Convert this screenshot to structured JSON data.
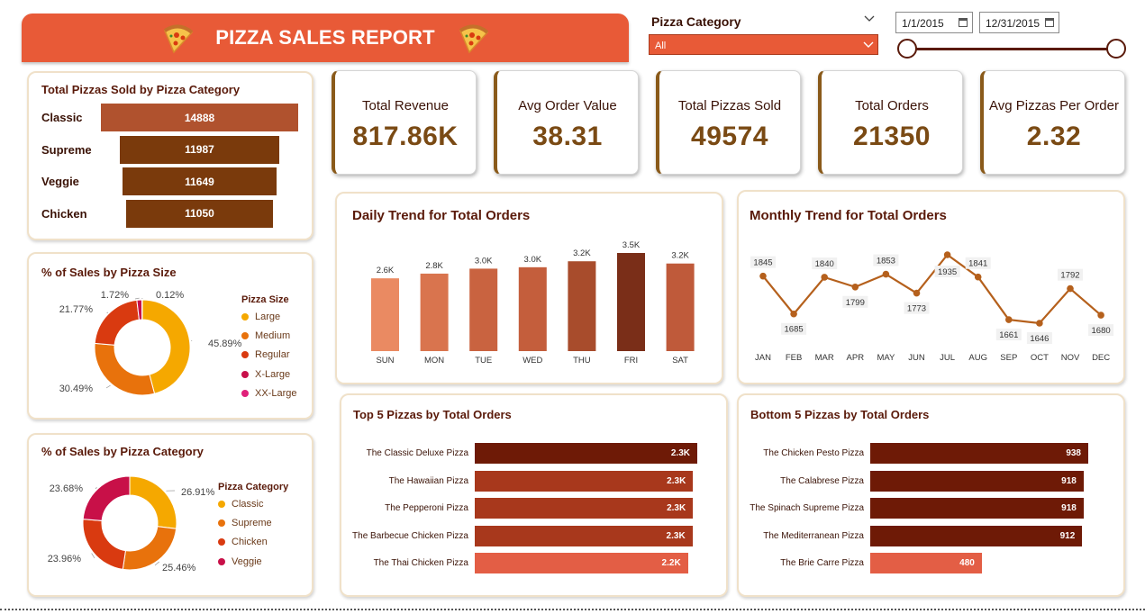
{
  "header": {
    "title": "PIZZA SALES REPORT"
  },
  "slicers": {
    "category_label": "Pizza Category",
    "category_value": "All",
    "date_start": "1/1/2015",
    "date_end": "12/31/2015"
  },
  "kpis": [
    {
      "label": "Total Revenue",
      "value": "817.86K"
    },
    {
      "label": "Avg Order Value",
      "value": "38.31"
    },
    {
      "label": "Total Pizzas Sold",
      "value": "49574"
    },
    {
      "label": "Total Orders",
      "value": "21350"
    },
    {
      "label": "Avg Pizzas Per Order",
      "value": "2.32"
    }
  ],
  "titles": {
    "funnel": "Total Pizzas Sold by Pizza Category",
    "size_donut": "% of Sales by Pizza Size",
    "cat_donut": "% of Sales by Pizza Category",
    "daily": "Daily Trend for Total Orders",
    "monthly": "Monthly Trend for Total Orders",
    "top5": "Top 5 Pizzas by Total Orders",
    "bottom5": "Bottom 5 Pizzas by Total Orders"
  },
  "colors": {
    "header": "#e85a37",
    "large": "#f5a800",
    "medium": "#e8720c",
    "regular": "#d93a10",
    "xlarge": "#c8104a",
    "xxlarge": "#e0207a",
    "veggie": "#c81048"
  },
  "chart_data": [
    {
      "id": "funnel",
      "type": "bar",
      "title": "Total Pizzas Sold by Pizza Category",
      "categories": [
        "Classic",
        "Supreme",
        "Veggie",
        "Chicken"
      ],
      "values": [
        14888,
        11987,
        11649,
        11050
      ],
      "labels": [
        "14888",
        "11987",
        "11649",
        "11050"
      ]
    },
    {
      "id": "size",
      "type": "pie",
      "title": "% of Sales by Pizza Size",
      "legend_title": "Pizza Size",
      "categories": [
        "Large",
        "Medium",
        "Regular",
        "X-Large",
        "XX-Large"
      ],
      "values": [
        45.89,
        30.49,
        21.77,
        1.72,
        0.12
      ],
      "labels": [
        "45.89%",
        "30.49%",
        "21.77%",
        "1.72%",
        "0.12%"
      ]
    },
    {
      "id": "category",
      "type": "pie",
      "title": "% of Sales by Pizza Category",
      "legend_title": "Pizza Category",
      "categories": [
        "Classic",
        "Supreme",
        "Chicken",
        "Veggie"
      ],
      "values": [
        26.91,
        25.46,
        23.96,
        23.68
      ],
      "labels": [
        "26.91%",
        "25.46%",
        "23.96%",
        "23.68%"
      ]
    },
    {
      "id": "daily",
      "type": "bar",
      "title": "Daily Trend for Total Orders",
      "categories": [
        "SUN",
        "MON",
        "TUE",
        "WED",
        "THU",
        "FRI",
        "SAT"
      ],
      "values": [
        2624,
        2794,
        2973,
        3024,
        3239,
        3538,
        3158
      ],
      "labels": [
        "2.6K",
        "2.8K",
        "3.0K",
        "3.0K",
        "3.2K",
        "3.5K",
        "3.2K"
      ],
      "ylim": [
        0,
        3600
      ]
    },
    {
      "id": "monthly",
      "type": "line",
      "title": "Monthly Trend for Total Orders",
      "categories": [
        "JAN",
        "FEB",
        "MAR",
        "APR",
        "MAY",
        "JUN",
        "JUL",
        "AUG",
        "SEP",
        "OCT",
        "NOV",
        "DEC"
      ],
      "values": [
        1845,
        1685,
        1840,
        1799,
        1853,
        1773,
        1935,
        1841,
        1661,
        1646,
        1792,
        1680
      ],
      "ylim": [
        1600,
        1960
      ]
    },
    {
      "id": "top5",
      "type": "bar",
      "title": "Top 5 Pizzas by Total Orders",
      "categories": [
        "The Classic Deluxe Pizza",
        "The Hawaiian Pizza",
        "The Pepperoni Pizza",
        "The Barbecue Chicken Pizza",
        "The Thai Chicken Pizza"
      ],
      "values": [
        2416,
        2370,
        2369,
        2364,
        2315
      ],
      "labels": [
        "2.3K",
        "2.3K",
        "2.3K",
        "2.3K",
        "2.2K"
      ]
    },
    {
      "id": "bottom5",
      "type": "bar",
      "title": "Bottom 5 Pizzas by Total Orders",
      "categories": [
        "The Chicken Pesto Pizza",
        "The Calabrese Pizza",
        "The Spinach Supreme Pizza",
        "The Mediterranean Pizza",
        "The Brie Carre Pizza"
      ],
      "values": [
        938,
        918,
        918,
        912,
        480
      ],
      "labels": [
        "938",
        "918",
        "918",
        "912",
        "480"
      ]
    }
  ]
}
